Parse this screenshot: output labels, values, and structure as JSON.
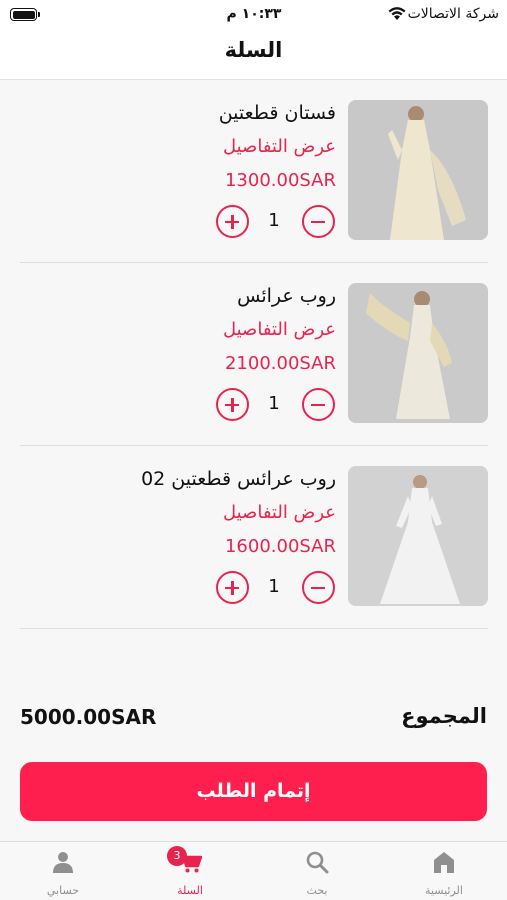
{
  "status_bar": {
    "carrier": "شركة الاتصالات",
    "time": "١٠:٣٣ م"
  },
  "header": {
    "title": "السلة"
  },
  "cart": {
    "items": [
      {
        "name": "فستان قطعتين",
        "details_label": "عرض التفاصيل",
        "price": "1300.00SAR",
        "quantity": "1"
      },
      {
        "name": "روب عرائس",
        "details_label": "عرض التفاصيل",
        "price": "2100.00SAR",
        "quantity": "1"
      },
      {
        "name": "روب عرائس قطعتين 02",
        "details_label": "عرض التفاصيل",
        "price": "1600.00SAR",
        "quantity": "1"
      }
    ]
  },
  "summary": {
    "total_label": "المجموع",
    "total_value": "5000.00SAR"
  },
  "checkout": {
    "label": "إتمام الطلب"
  },
  "tab_bar": {
    "tabs": [
      {
        "label": "حسابي",
        "icon": "person-icon"
      },
      {
        "label": "السلة",
        "icon": "cart-icon",
        "badge": "3"
      },
      {
        "label": "بحث",
        "icon": "search-icon"
      },
      {
        "label": "الرئيسية",
        "icon": "home-icon"
      }
    ]
  },
  "colors": {
    "accent": "#e8244e",
    "button": "#ff1f4e",
    "inactive_tab": "#8f8f8f"
  }
}
